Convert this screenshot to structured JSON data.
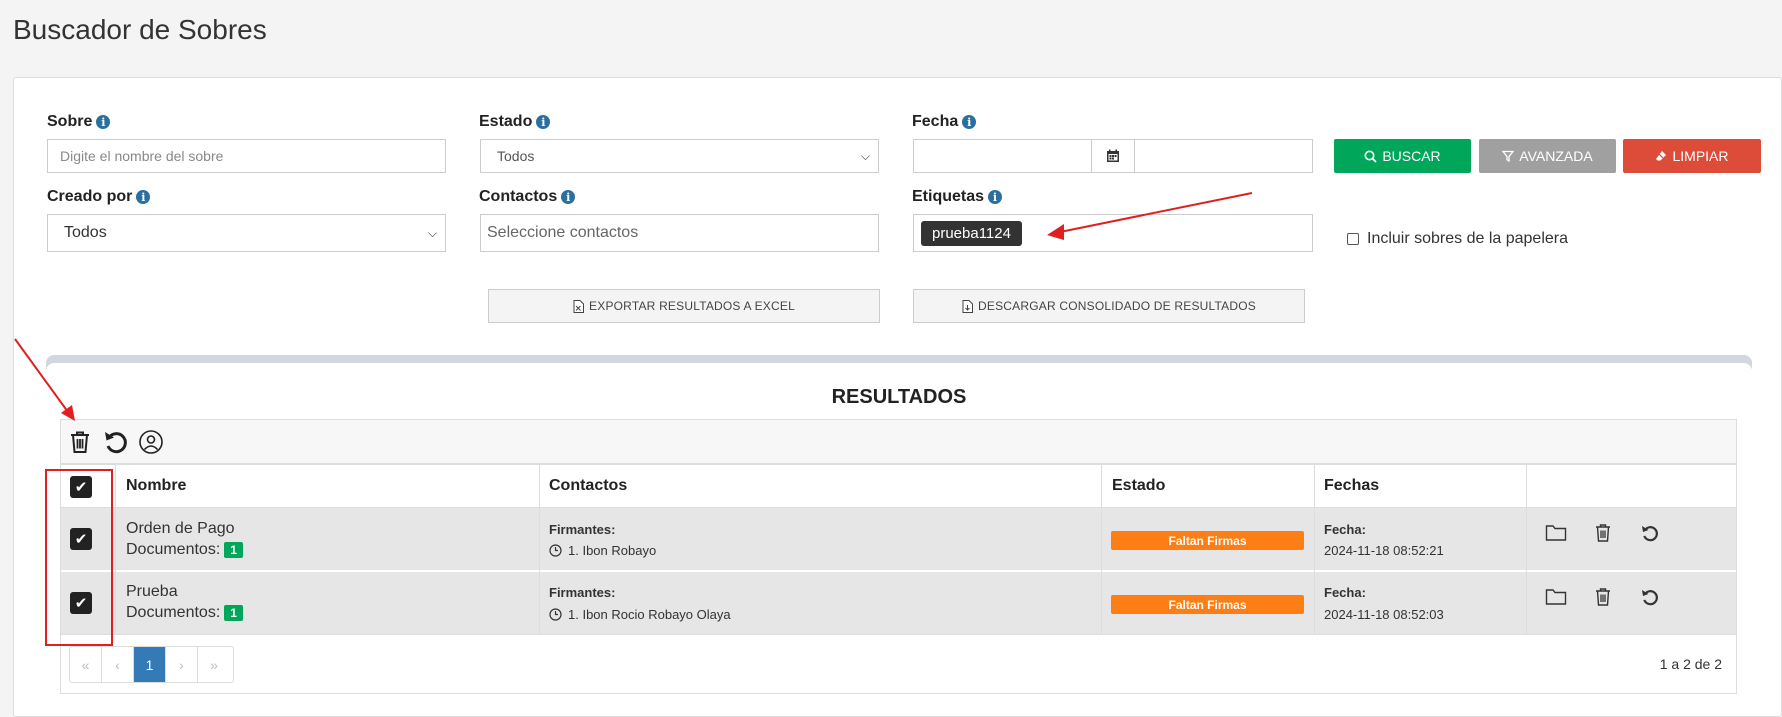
{
  "page": {
    "title": "Buscador de Sobres"
  },
  "filters": {
    "sobre": {
      "label": "Sobre",
      "placeholder": "Digite el nombre del sobre"
    },
    "estado": {
      "label": "Estado",
      "value": "Todos"
    },
    "fecha": {
      "label": "Fecha"
    },
    "creado_por": {
      "label": "Creado por",
      "value": "Todos"
    },
    "contactos": {
      "label": "Contactos",
      "placeholder": "Seleccione contactos"
    },
    "etiquetas": {
      "label": "Etiquetas",
      "tag": "prueba1124"
    },
    "papelera": {
      "label": "Incluir sobres de la papelera"
    }
  },
  "buttons": {
    "buscar": "BUSCAR",
    "avanzada": "AVANZADA",
    "limpiar": "LIMPIAR",
    "exportar": "EXPORTAR RESULTADOS A EXCEL",
    "descargar": "DESCARGAR CONSOLIDADO DE RESULTADOS"
  },
  "results": {
    "title": "RESULTADOS",
    "columns": {
      "nombre": "Nombre",
      "contactos": "Contactos",
      "estado": "Estado",
      "fechas": "Fechas"
    },
    "rows": [
      {
        "nombre": "Orden de Pago",
        "documentos_label": "Documentos:",
        "documentos_count": "1",
        "firmantes_label": "Firmantes:",
        "firmante": "1. Ibon Robayo",
        "estado": "Faltan Firmas",
        "fecha_label": "Fecha:",
        "fecha": "2024-11-18 08:52:21"
      },
      {
        "nombre": "Prueba",
        "documentos_label": "Documentos:",
        "documentos_count": "1",
        "firmantes_label": "Firmantes:",
        "firmante": "1. Ibon Rocio Robayo Olaya",
        "estado": "Faltan Firmas",
        "fecha_label": "Fecha:",
        "fecha": "2024-11-18 08:52:03"
      }
    ],
    "pagination": {
      "current": "1",
      "summary": "1 a 2 de 2"
    }
  },
  "colors": {
    "primary_green": "#00a65a",
    "advanced_gray": "#a0a0a0",
    "danger_red": "#dd4b39",
    "status_orange": "#fd7e14",
    "page_active": "#337ab7",
    "annotation_red": "#e02020"
  },
  "icons": [
    "info-icon",
    "search-icon",
    "filter-icon",
    "eraser-icon",
    "calendar-icon",
    "excel-file-icon",
    "download-file-icon",
    "trash-icon",
    "undo-icon",
    "user-circle-icon",
    "folder-icon",
    "clock-icon",
    "check-icon",
    "chevron-down-icon"
  ]
}
